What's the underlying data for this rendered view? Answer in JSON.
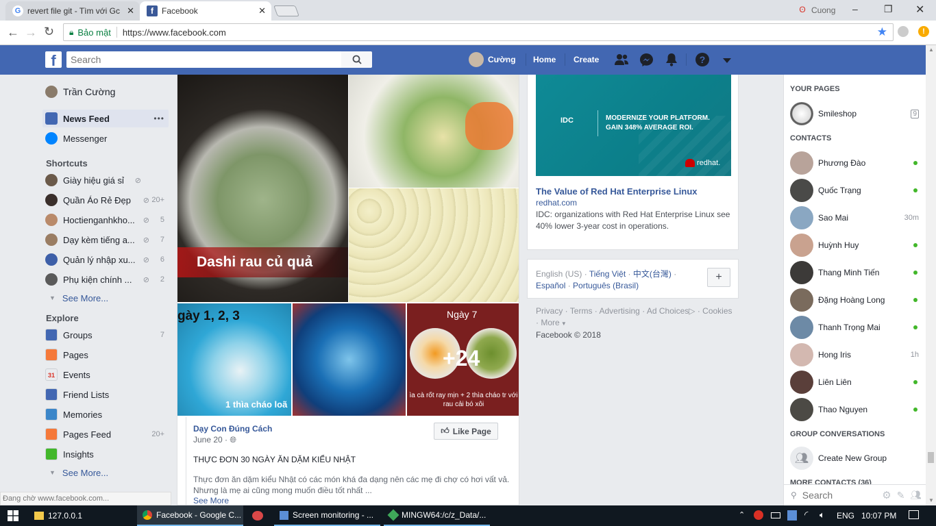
{
  "browser": {
    "tabs": [
      {
        "title": "revert file git - Tìm với Gc",
        "close": "✕"
      },
      {
        "title": "Facebook",
        "close": "✕"
      }
    ],
    "profile_name": "Cuong",
    "window_controls": {
      "minimize": "–",
      "maximize": "❐",
      "close": "✕"
    },
    "security_label": "Bảo mật",
    "url": "https://www.facebook.com"
  },
  "fb_header": {
    "search_placeholder": "Search",
    "user_name": "Cường",
    "home": "Home",
    "create": "Create"
  },
  "left_nav": {
    "profile": "Trần Cường",
    "news_feed": "News Feed",
    "news_feed_more": "•••",
    "messenger": "Messenger",
    "shortcuts_heading": "Shortcuts",
    "shortcuts": [
      {
        "label": "Giày hiệu giá sỉ",
        "count": ""
      },
      {
        "label": "Quần Áo Rẻ Đẹp",
        "count": "20+"
      },
      {
        "label": "Hoctienganhkho...",
        "count": "5"
      },
      {
        "label": "Dạy kèm tiếng a...",
        "count": "7"
      },
      {
        "label": "Quản lý nhập xu...",
        "count": "6"
      },
      {
        "label": "Phụ kiện chính ...",
        "count": "2"
      }
    ],
    "see_more_1": "See More...",
    "explore_heading": "Explore",
    "explore": [
      {
        "label": "Groups",
        "count": "7",
        "color": "#4267b2"
      },
      {
        "label": "Pages",
        "count": "",
        "color": "#f5793a"
      },
      {
        "label": "Events",
        "count": "",
        "color": "#e9ebee"
      },
      {
        "label": "Friend Lists",
        "count": "",
        "color": "#4267b2"
      },
      {
        "label": "Memories",
        "count": "",
        "color": "#3b86c9"
      },
      {
        "label": "Pages Feed",
        "count": "20+",
        "color": "#f5793a"
      },
      {
        "label": "Insights",
        "count": "",
        "color": "#42b72a"
      }
    ],
    "events_day": "31",
    "see_more_2": "See More...",
    "status": "Đang chờ www.facebook.com..."
  },
  "post": {
    "caption_main": "Dashi rau củ quả",
    "thumb1_top": "gày 1, 2, 3",
    "thumb1_bottom": "1 thìa cháo loã",
    "thumb3_top": "Ngày 7",
    "thumb3_bottom": "ìa cà rốt ray mịn + 2 thìa cháo tr với rau cải bó xôi",
    "more_count": "+24",
    "page_name": "Dạy Con Đúng Cách",
    "date": "June 20 · ",
    "like_page": "Like Page",
    "title": "THỰC ĐƠN 30 NGÀY ĂN DẶM KIỂU NHẬT",
    "body": "Thực đơn ăn dặm kiểu Nhật có các món khá đa dạng nên các mẹ đi chợ có hơi vất vả. Nhưng là mẹ ai cũng mong muốn điều tốt nhất ...",
    "see_more": "See More"
  },
  "ad": {
    "banner_brand": "IDC",
    "banner_line1": "MODERNIZE YOUR PLATFORM.",
    "banner_line2": "GAIN 348% AVERAGE ROI.",
    "banner_logo": "redhat.",
    "title": "The Value of Red Hat Enterprise Linux",
    "domain": "redhat.com",
    "desc": "IDC: organizations with Red Hat Enterprise Linux see 40% lower 3-year cost in operations."
  },
  "languages": {
    "current": "English (US)",
    "others": [
      "Tiếng Việt",
      "中文(台灣)",
      "Español",
      "Português (Brasil)"
    ],
    "add": "+"
  },
  "footer": {
    "links": [
      "Privacy",
      "Terms",
      "Advertising",
      "Ad Choices",
      "Cookies",
      "More"
    ],
    "copyright": "Facebook © 2018"
  },
  "right_sidebar": {
    "your_pages": "YOUR PAGES",
    "page_name": "Smileshop",
    "page_badge": "9",
    "contacts_heading": "CONTACTS",
    "contacts": [
      {
        "name": "Phương Đào",
        "status": "online",
        "time": ""
      },
      {
        "name": "Quốc Trạng",
        "status": "online",
        "time": ""
      },
      {
        "name": "Sao Mai",
        "status": "idle",
        "time": "30m"
      },
      {
        "name": "Huỳnh Huy",
        "status": "online",
        "time": ""
      },
      {
        "name": "Thang Minh Tiến",
        "status": "online",
        "time": ""
      },
      {
        "name": "Đặng Hoàng Long",
        "status": "online",
        "time": ""
      },
      {
        "name": "Thanh Trọng Mai",
        "status": "online",
        "time": ""
      },
      {
        "name": "Hong Iris",
        "status": "idle",
        "time": "1h"
      },
      {
        "name": "Liên Liên",
        "status": "online",
        "time": ""
      },
      {
        "name": "Thao Nguyen",
        "status": "online",
        "time": ""
      }
    ],
    "group_conv": "GROUP CONVERSATIONS",
    "create_group": "Create New Group",
    "more_contacts": "MORE CONTACTS (36)",
    "search_placeholder": "Search"
  },
  "taskbar": {
    "items": [
      "127.0.0.1",
      "Facebook - Google C...",
      "",
      "Screen monitoring - ...",
      "MINGW64:/c/z_Data/..."
    ],
    "lang": "ENG",
    "time": "10:07 PM"
  }
}
